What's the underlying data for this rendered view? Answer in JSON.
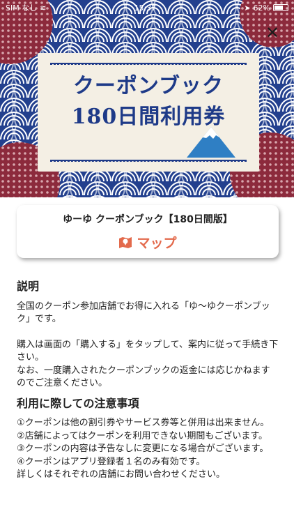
{
  "status_bar": {
    "carrier": "SIM なし",
    "time": "15:37",
    "battery": "62%"
  },
  "banner": {
    "title_line1": "クーポンブック",
    "title_line2": "180日間利用券"
  },
  "card": {
    "title": "ゆーゆ クーポンブック【180日間版】",
    "map_label": "マップ",
    "accent_color": "#e36a4c"
  },
  "description": {
    "heading": "説明",
    "para1": "全国のクーポン参加店舗でお得に入れる「ゆ〜ゆクーポンブック」です。",
    "para2_line1": "購入は画面の「購入する」をタップして、案内に従って手続き下さい。",
    "para2_line2": "なお、一度購入されたクーポンブックの返金には応じかねますのでご注意ください。"
  },
  "notes": {
    "heading": "利用に際しての注意事項",
    "items": [
      "①クーポンは他の割引券やサービス券等と併用は出来ません。",
      "②店舗によってはクーポンを利用できない期間もございます。",
      "③クーポンの内容は予告なしに変更になる場合がございます。",
      "④クーポンはアプリ登録者１名のみ有効です。",
      "詳しくはそれぞれの店舗にお問い合わせください。"
    ]
  },
  "colors": {
    "wave_blue": "#23408e",
    "banner_bg": "#f4efe4",
    "dot_red": "#8c2a3c"
  }
}
